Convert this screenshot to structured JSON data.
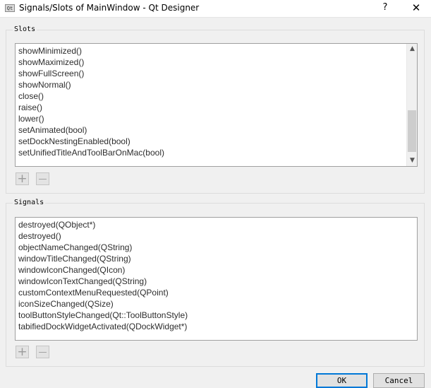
{
  "window": {
    "icon_text": "Qt",
    "title": "Signals/Slots of MainWindow - Qt Designer",
    "help_label": "?",
    "close_label": "✕"
  },
  "slots": {
    "label": "Slots",
    "items": [
      "showMinimized()",
      "showMaximized()",
      "showFullScreen()",
      "showNormal()",
      "close()",
      "raise()",
      "lower()",
      "setAnimated(bool)",
      "setDockNestingEnabled(bool)",
      "setUnifiedTitleAndToolBarOnMac(bool)"
    ],
    "add_label": "+",
    "remove_label": "—"
  },
  "signals": {
    "label": "Signals",
    "items": [
      "destroyed(QObject*)",
      "destroyed()",
      "objectNameChanged(QString)",
      "windowTitleChanged(QString)",
      "windowIconChanged(QIcon)",
      "windowIconTextChanged(QString)",
      "customContextMenuRequested(QPoint)",
      "iconSizeChanged(QSize)",
      "toolButtonStyleChanged(Qt::ToolButtonStyle)",
      "tabifiedDockWidgetActivated(QDockWidget*)"
    ],
    "add_label": "+",
    "remove_label": "—"
  },
  "buttons": {
    "ok_label": "OK",
    "cancel_label": "Cancel"
  },
  "colors": {
    "accent": "#0078d7",
    "background": "#f0f0f0"
  }
}
